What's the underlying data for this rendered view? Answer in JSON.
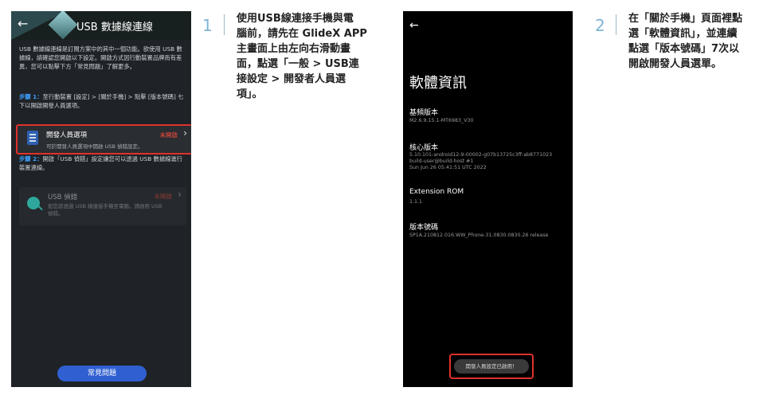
{
  "screen1": {
    "header_title": "USB 數據線連線",
    "back_glyph": "←",
    "intro": "USB 數據線連線是訂閱方案中的其中一個功能。欲使用 USB 數據線，請確認您開啟以下設定。開啟方式因行動裝置品牌而有差異，您可以點擊下方「常見問題」了解更多。",
    "step1_lead": "步驟 1：",
    "step1_text": "至行動裝置 [設定] > [關於手機] > 點擊 [版本號碼] 七下以開啟開發人員選項。",
    "dev_option": {
      "title": "開發人員選項",
      "subtitle": "可於開發人員選項中開啟 USB 偵錯設定。",
      "status": "未開啟",
      "chevron": "›"
    },
    "step2_lead": "步驟 2：",
    "step2_text": "開啟「USB 偵錯」設定讓您可以透過 USB 數據線進行裝置連線。",
    "usb_debug": {
      "title": "USB 偵錯",
      "subtitle": "如您欲透過 USB 線連接手機至電腦，請啟用 USB 偵錯。",
      "status": "未開啟",
      "chevron": "›"
    },
    "faq_button": "常見問題"
  },
  "instruction1": {
    "number": "1",
    "lines": [
      "使用USB線連接手機與電",
      "腦前，請先在 GlideX APP",
      "主畫面上由左向右滑動畫",
      "面，點選「一般 > USB連",
      "接設定 > 開發者人員選",
      "項」。"
    ]
  },
  "screen2": {
    "back_glyph": "←",
    "title": "軟體資訊",
    "baseband_label": "基頻版本",
    "baseband_value": "M2.6.9.15.1-MT6983_V30",
    "kernel_label": "核心版本",
    "kernel_value_lines": [
      "5.10.101-android12-9-00002-g07b13725c3ff-ab8771023",
      "build-user@build-host #1",
      "Sun Jun 26 05:41:51 UTC 2022"
    ],
    "ext_rom_label": "Extension ROM",
    "ext_rom_value": "1.1.1",
    "build_label": "版本號碼",
    "build_value": "SP1A.210812.016.WW_Phone-31.0830.0830.26 release",
    "toast": "開發人員設定已啟用！"
  },
  "instruction2": {
    "number": "2",
    "lines": [
      "在「關於手機」頁面裡點",
      "選「軟體資訊」，並連續",
      "點選「版本號碼」7次以",
      "開啟開發人員選單。"
    ]
  }
}
